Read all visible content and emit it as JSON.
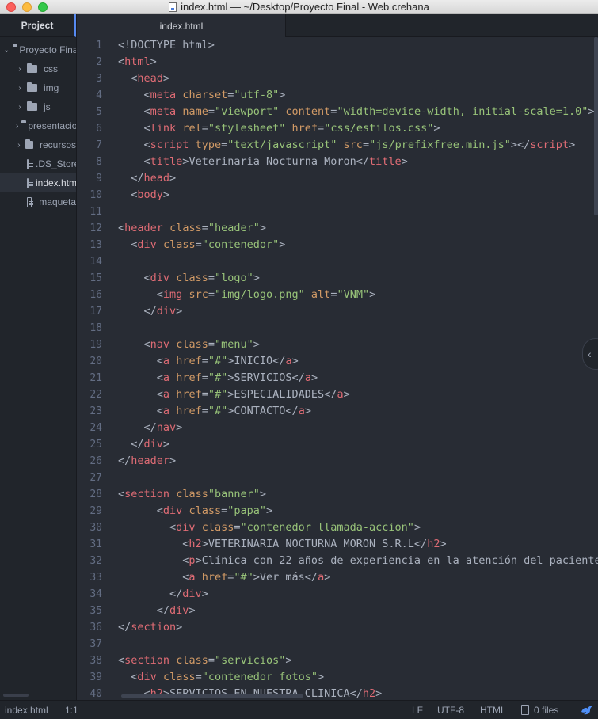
{
  "window": {
    "title": "index.html — ~/Desktop/Proyecto Final - Web crehana"
  },
  "sidebar": {
    "tab_label": "Project",
    "root": "Proyecto Final",
    "folders": [
      "css",
      "img",
      "js",
      "presentacion",
      "recursos"
    ],
    "files": [
      ".DS_Store",
      "index.html",
      "maqueta"
    ]
  },
  "editor": {
    "tab_label": "index.html"
  },
  "code_lines": [
    {
      "n": "1",
      "html": "<span class=\"p\">&lt;!DOCTYPE html&gt;</span>"
    },
    {
      "n": "2",
      "html": "<span class=\"p\">&lt;</span><span class=\"t\">html</span><span class=\"p\">&gt;</span>"
    },
    {
      "n": "3",
      "html": "  <span class=\"p\">&lt;</span><span class=\"t\">head</span><span class=\"p\">&gt;</span>"
    },
    {
      "n": "4",
      "html": "    <span class=\"p\">&lt;</span><span class=\"t\">meta</span> <span class=\"a\">charset</span><span class=\"p\">=</span><span class=\"s\">\"utf-8\"</span><span class=\"p\">&gt;</span>"
    },
    {
      "n": "5",
      "html": "    <span class=\"p\">&lt;</span><span class=\"t\">meta</span> <span class=\"a\">name</span><span class=\"p\">=</span><span class=\"s\">\"viewport\"</span> <span class=\"a\">content</span><span class=\"p\">=</span><span class=\"s\">\"width=device-width, initial-scale=1.0\"</span><span class=\"p\">&gt;</span>"
    },
    {
      "n": "6",
      "html": "    <span class=\"p\">&lt;</span><span class=\"t\">link</span> <span class=\"a\">rel</span><span class=\"p\">=</span><span class=\"s\">\"stylesheet\"</span> <span class=\"a\">href</span><span class=\"p\">=</span><span class=\"s\">\"css/estilos.css\"</span><span class=\"p\">&gt;</span>"
    },
    {
      "n": "7",
      "html": "    <span class=\"p\">&lt;</span><span class=\"t\">script</span> <span class=\"a\">type</span><span class=\"p\">=</span><span class=\"s\">\"text/javascript\"</span> <span class=\"a\">src</span><span class=\"p\">=</span><span class=\"s\">\"js/prefixfree.min.js\"</span><span class=\"p\">&gt;&lt;/</span><span class=\"t\">script</span><span class=\"p\">&gt;</span>"
    },
    {
      "n": "8",
      "html": "    <span class=\"p\">&lt;</span><span class=\"t\">title</span><span class=\"p\">&gt;</span>Veterinaria Nocturna Moron<span class=\"p\">&lt;/</span><span class=\"t\">title</span><span class=\"p\">&gt;</span>"
    },
    {
      "n": "9",
      "html": "  <span class=\"p\">&lt;/</span><span class=\"t\">head</span><span class=\"p\">&gt;</span>"
    },
    {
      "n": "10",
      "html": "  <span class=\"p\">&lt;</span><span class=\"t\">body</span><span class=\"p\">&gt;</span>"
    },
    {
      "n": "11",
      "html": ""
    },
    {
      "n": "12",
      "html": "<span class=\"p\">&lt;</span><span class=\"t\">header</span> <span class=\"a\">class</span><span class=\"p\">=</span><span class=\"s\">\"header\"</span><span class=\"p\">&gt;</span>"
    },
    {
      "n": "13",
      "html": "  <span class=\"p\">&lt;</span><span class=\"t\">div</span> <span class=\"a\">class</span><span class=\"p\">=</span><span class=\"s\">\"contenedor\"</span><span class=\"p\">&gt;</span>"
    },
    {
      "n": "14",
      "html": ""
    },
    {
      "n": "15",
      "html": "    <span class=\"p\">&lt;</span><span class=\"t\">div</span> <span class=\"a\">class</span><span class=\"p\">=</span><span class=\"s\">\"logo\"</span><span class=\"p\">&gt;</span>"
    },
    {
      "n": "16",
      "html": "      <span class=\"p\">&lt;</span><span class=\"t\">img</span> <span class=\"a\">src</span><span class=\"p\">=</span><span class=\"s\">\"img/logo.png\"</span> <span class=\"a\">alt</span><span class=\"p\">=</span><span class=\"s\">\"VNM\"</span><span class=\"p\">&gt;</span>"
    },
    {
      "n": "17",
      "html": "    <span class=\"p\">&lt;/</span><span class=\"t\">div</span><span class=\"p\">&gt;</span>"
    },
    {
      "n": "18",
      "html": ""
    },
    {
      "n": "19",
      "html": "    <span class=\"p\">&lt;</span><span class=\"t\">nav</span> <span class=\"a\">class</span><span class=\"p\">=</span><span class=\"s\">\"menu\"</span><span class=\"p\">&gt;</span>"
    },
    {
      "n": "20",
      "html": "      <span class=\"p\">&lt;</span><span class=\"t\">a</span> <span class=\"a\">href</span><span class=\"p\">=</span><span class=\"s\">\"#\"</span><span class=\"p\">&gt;</span>INICIO<span class=\"p\">&lt;/</span><span class=\"t\">a</span><span class=\"p\">&gt;</span>"
    },
    {
      "n": "21",
      "html": "      <span class=\"p\">&lt;</span><span class=\"t\">a</span> <span class=\"a\">href</span><span class=\"p\">=</span><span class=\"s\">\"#\"</span><span class=\"p\">&gt;</span>SERVICIOS<span class=\"p\">&lt;/</span><span class=\"t\">a</span><span class=\"p\">&gt;</span>"
    },
    {
      "n": "22",
      "html": "      <span class=\"p\">&lt;</span><span class=\"t\">a</span> <span class=\"a\">href</span><span class=\"p\">=</span><span class=\"s\">\"#\"</span><span class=\"p\">&gt;</span>ESPECIALIDADES<span class=\"p\">&lt;/</span><span class=\"t\">a</span><span class=\"p\">&gt;</span>"
    },
    {
      "n": "23",
      "html": "      <span class=\"p\">&lt;</span><span class=\"t\">a</span> <span class=\"a\">href</span><span class=\"p\">=</span><span class=\"s\">\"#\"</span><span class=\"p\">&gt;</span>CONTACTO<span class=\"p\">&lt;/</span><span class=\"t\">a</span><span class=\"p\">&gt;</span>"
    },
    {
      "n": "24",
      "html": "    <span class=\"p\">&lt;/</span><span class=\"t\">nav</span><span class=\"p\">&gt;</span>"
    },
    {
      "n": "25",
      "html": "  <span class=\"p\">&lt;/</span><span class=\"t\">div</span><span class=\"p\">&gt;</span>"
    },
    {
      "n": "26",
      "html": "<span class=\"p\">&lt;/</span><span class=\"t\">header</span><span class=\"p\">&gt;</span>"
    },
    {
      "n": "27",
      "html": ""
    },
    {
      "n": "28",
      "html": "<span class=\"p\">&lt;</span><span class=\"t\">section</span> <span class=\"a\">class</span><span class=\"s\">\"banner\"</span><span class=\"p\">&gt;</span>"
    },
    {
      "n": "29",
      "html": "      <span class=\"p\">&lt;</span><span class=\"t\">div</span> <span class=\"a\">class</span><span class=\"p\">=</span><span class=\"s\">\"papa\"</span><span class=\"p\">&gt;</span>"
    },
    {
      "n": "30",
      "html": "        <span class=\"p\">&lt;</span><span class=\"t\">div</span> <span class=\"a\">class</span><span class=\"p\">=</span><span class=\"s\">\"contenedor llamada-accion\"</span><span class=\"p\">&gt;</span>"
    },
    {
      "n": "31",
      "html": "          <span class=\"p\">&lt;</span><span class=\"t\">h2</span><span class=\"p\">&gt;</span>VETERINARIA NOCTURNA MORON S.R.L<span class=\"p\">&lt;/</span><span class=\"t\">h2</span><span class=\"p\">&gt;</span>"
    },
    {
      "n": "32",
      "html": "          <span class=\"p\">&lt;</span><span class=\"t\">p</span><span class=\"p\">&gt;</span>Clínica con 22 años de experiencia en la atención del paciente"
    },
    {
      "n": "33",
      "html": "          <span class=\"p\">&lt;</span><span class=\"t\">a</span> <span class=\"a\">href</span><span class=\"p\">=</span><span class=\"s\">\"#\"</span><span class=\"p\">&gt;</span>Ver más<span class=\"p\">&lt;/</span><span class=\"t\">a</span><span class=\"p\">&gt;</span>"
    },
    {
      "n": "34",
      "html": "        <span class=\"p\">&lt;/</span><span class=\"t\">div</span><span class=\"p\">&gt;</span>"
    },
    {
      "n": "35",
      "html": "      <span class=\"p\">&lt;/</span><span class=\"t\">div</span><span class=\"p\">&gt;</span>"
    },
    {
      "n": "36",
      "html": "<span class=\"p\">&lt;/</span><span class=\"t\">section</span><span class=\"p\">&gt;</span>"
    },
    {
      "n": "37",
      "html": ""
    },
    {
      "n": "38",
      "html": "<span class=\"p\">&lt;</span><span class=\"t\">section</span> <span class=\"a\">class</span><span class=\"p\">=</span><span class=\"s\">\"servicios\"</span><span class=\"p\">&gt;</span>"
    },
    {
      "n": "39",
      "html": "  <span class=\"p\">&lt;</span><span class=\"t\">div</span> <span class=\"a\">class</span><span class=\"p\">=</span><span class=\"s\">\"contenedor fotos\"</span><span class=\"p\">&gt;</span>"
    },
    {
      "n": "40",
      "html": "    <span class=\"p\">&lt;</span><span class=\"t\">h2</span><span class=\"p\">&gt;</span>SERVICIOS EN NUESTRA CLINICA<span class=\"p\">&lt;/</span><span class=\"t\">h2</span><span class=\"p\">&gt;</span>"
    }
  ],
  "status": {
    "file": "index.html",
    "cursor": "1:1",
    "line_ending": "LF",
    "encoding": "UTF-8",
    "grammar": "HTML",
    "git_files": "0 files"
  },
  "colors": {
    "tag": "#e06c75",
    "attribute": "#d19a66",
    "string": "#98c379",
    "text": "#abb2bf",
    "background": "#282c34",
    "panel": "#21252b"
  },
  "icons": [
    "document-icon",
    "folder-icon",
    "file-icon",
    "chevron-right-icon",
    "chevron-down-icon",
    "chevron-left-icon",
    "bird-icon"
  ]
}
